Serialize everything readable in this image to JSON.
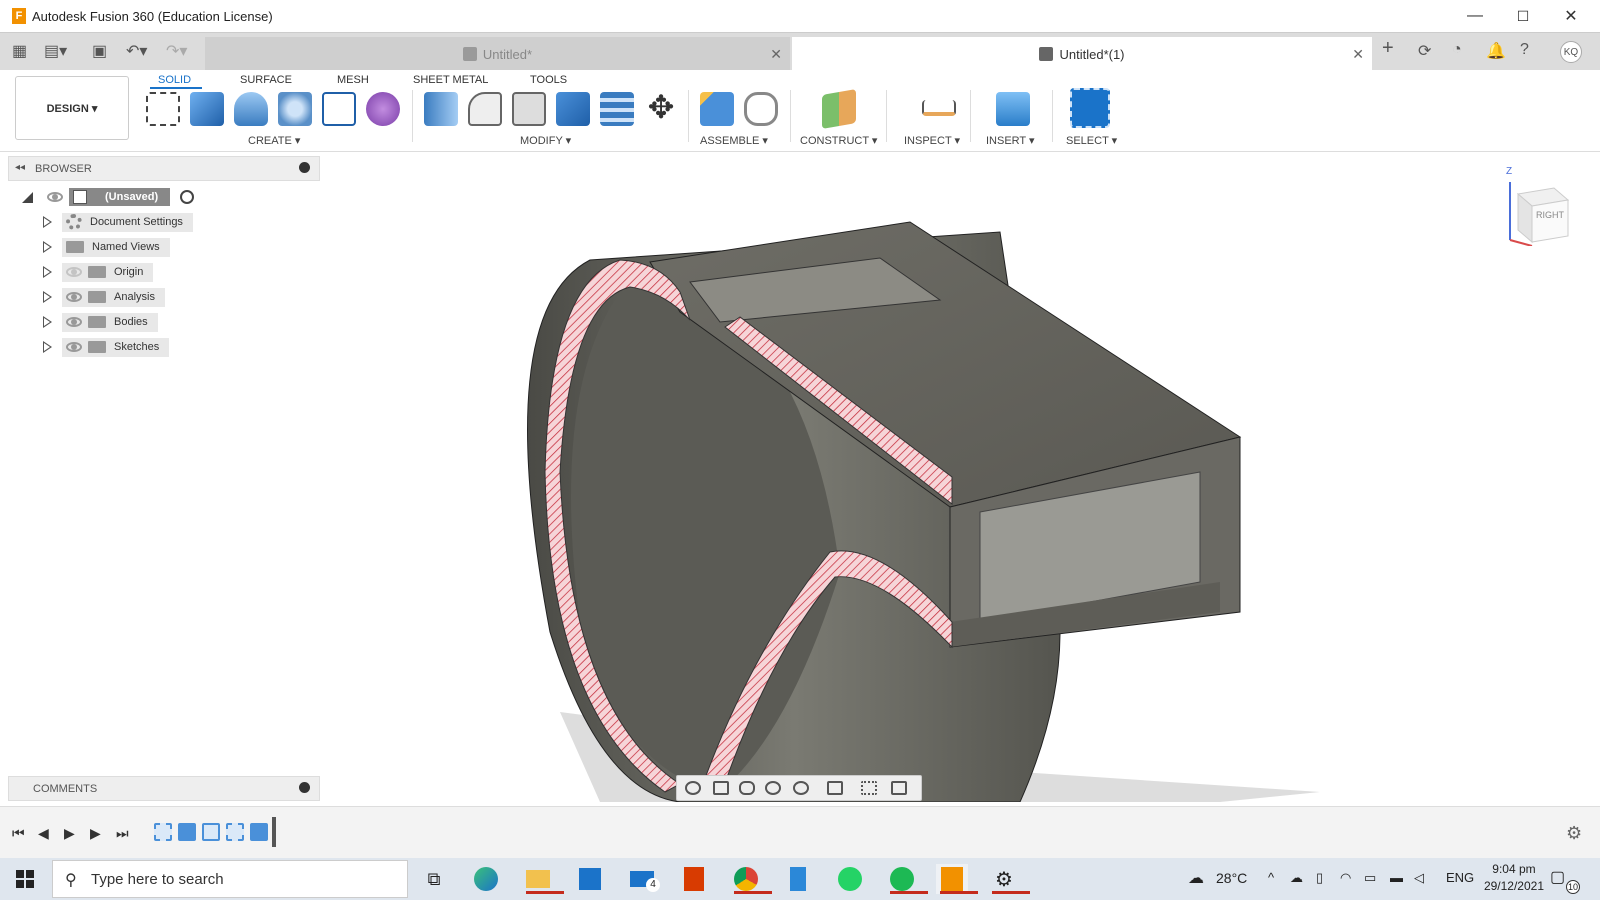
{
  "window": {
    "title": "Autodesk Fusion 360 (Education License)",
    "logo_letter": "F",
    "minimize": "—",
    "maximize": "☐",
    "close": "✕"
  },
  "tabs": [
    {
      "label": "Untitled*",
      "active": false
    },
    {
      "label": "Untitled*(1)",
      "active": true
    }
  ],
  "user_initials": "KQ",
  "ribbon": {
    "workspace": "DESIGN ▾",
    "tabs": [
      "SOLID",
      "SURFACE",
      "MESH",
      "SHEET METAL",
      "TOOLS"
    ],
    "active_tab": "SOLID",
    "groups": {
      "create": "CREATE ▾",
      "modify": "MODIFY ▾",
      "assemble": "ASSEMBLE ▾",
      "construct": "CONSTRUCT ▾",
      "inspect": "INSPECT ▾",
      "insert": "INSERT ▾",
      "select": "SELECT ▾"
    },
    "accent": "#1a73c9"
  },
  "browser": {
    "title": "BROWSER",
    "root": "(Unsaved)",
    "items": [
      {
        "label": "Document Settings",
        "icon": "gear-icon"
      },
      {
        "label": "Named Views",
        "icon": "folder-icon"
      },
      {
        "label": "Origin",
        "icon": "folder-icon"
      },
      {
        "label": "Analysis",
        "icon": "folder-icon"
      },
      {
        "label": "Bodies",
        "icon": "folder-icon"
      },
      {
        "label": "Sketches",
        "icon": "folder-icon"
      }
    ]
  },
  "comments": {
    "title": "COMMENTS"
  },
  "viewcube": {
    "face": "RIGHT",
    "axis_z": "Z"
  },
  "taskbar": {
    "search_placeholder": "Type here to search",
    "mail_badge": "4",
    "weather": "28°C",
    "language": "ENG",
    "time": "9:04 pm",
    "date": "29/12/2021",
    "notifications": "10"
  }
}
